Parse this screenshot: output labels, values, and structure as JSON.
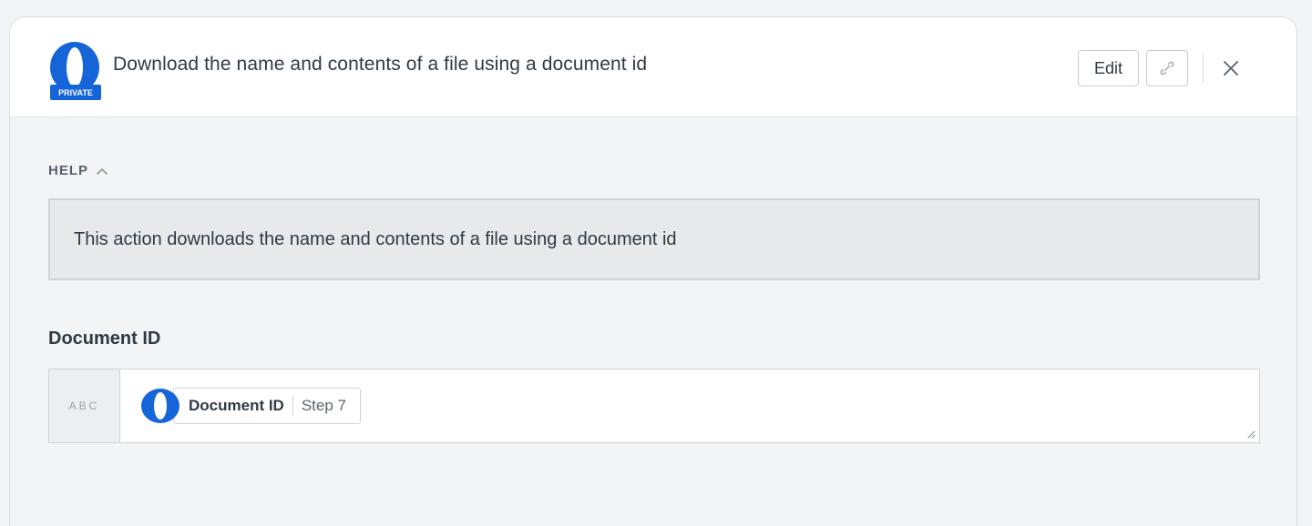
{
  "header": {
    "title": "Download the name and contents of a file using a document id",
    "logo_badge": "PRIVATE",
    "edit_label": "Edit",
    "link_icon": "link-icon",
    "close_icon": "close-icon"
  },
  "help": {
    "toggle_label": "HELP",
    "toggle_icon": "chevron-up-icon",
    "text": "This action downloads the name and contents of a file using a document id"
  },
  "field": {
    "label": "Document ID",
    "type_label": "ABC",
    "pill": {
      "name": "Document ID",
      "step": "Step 7"
    }
  },
  "colors": {
    "brand_blue": "#1565d8",
    "panel_bg": "#f3f4f6",
    "help_bg": "#e8e9ea"
  }
}
